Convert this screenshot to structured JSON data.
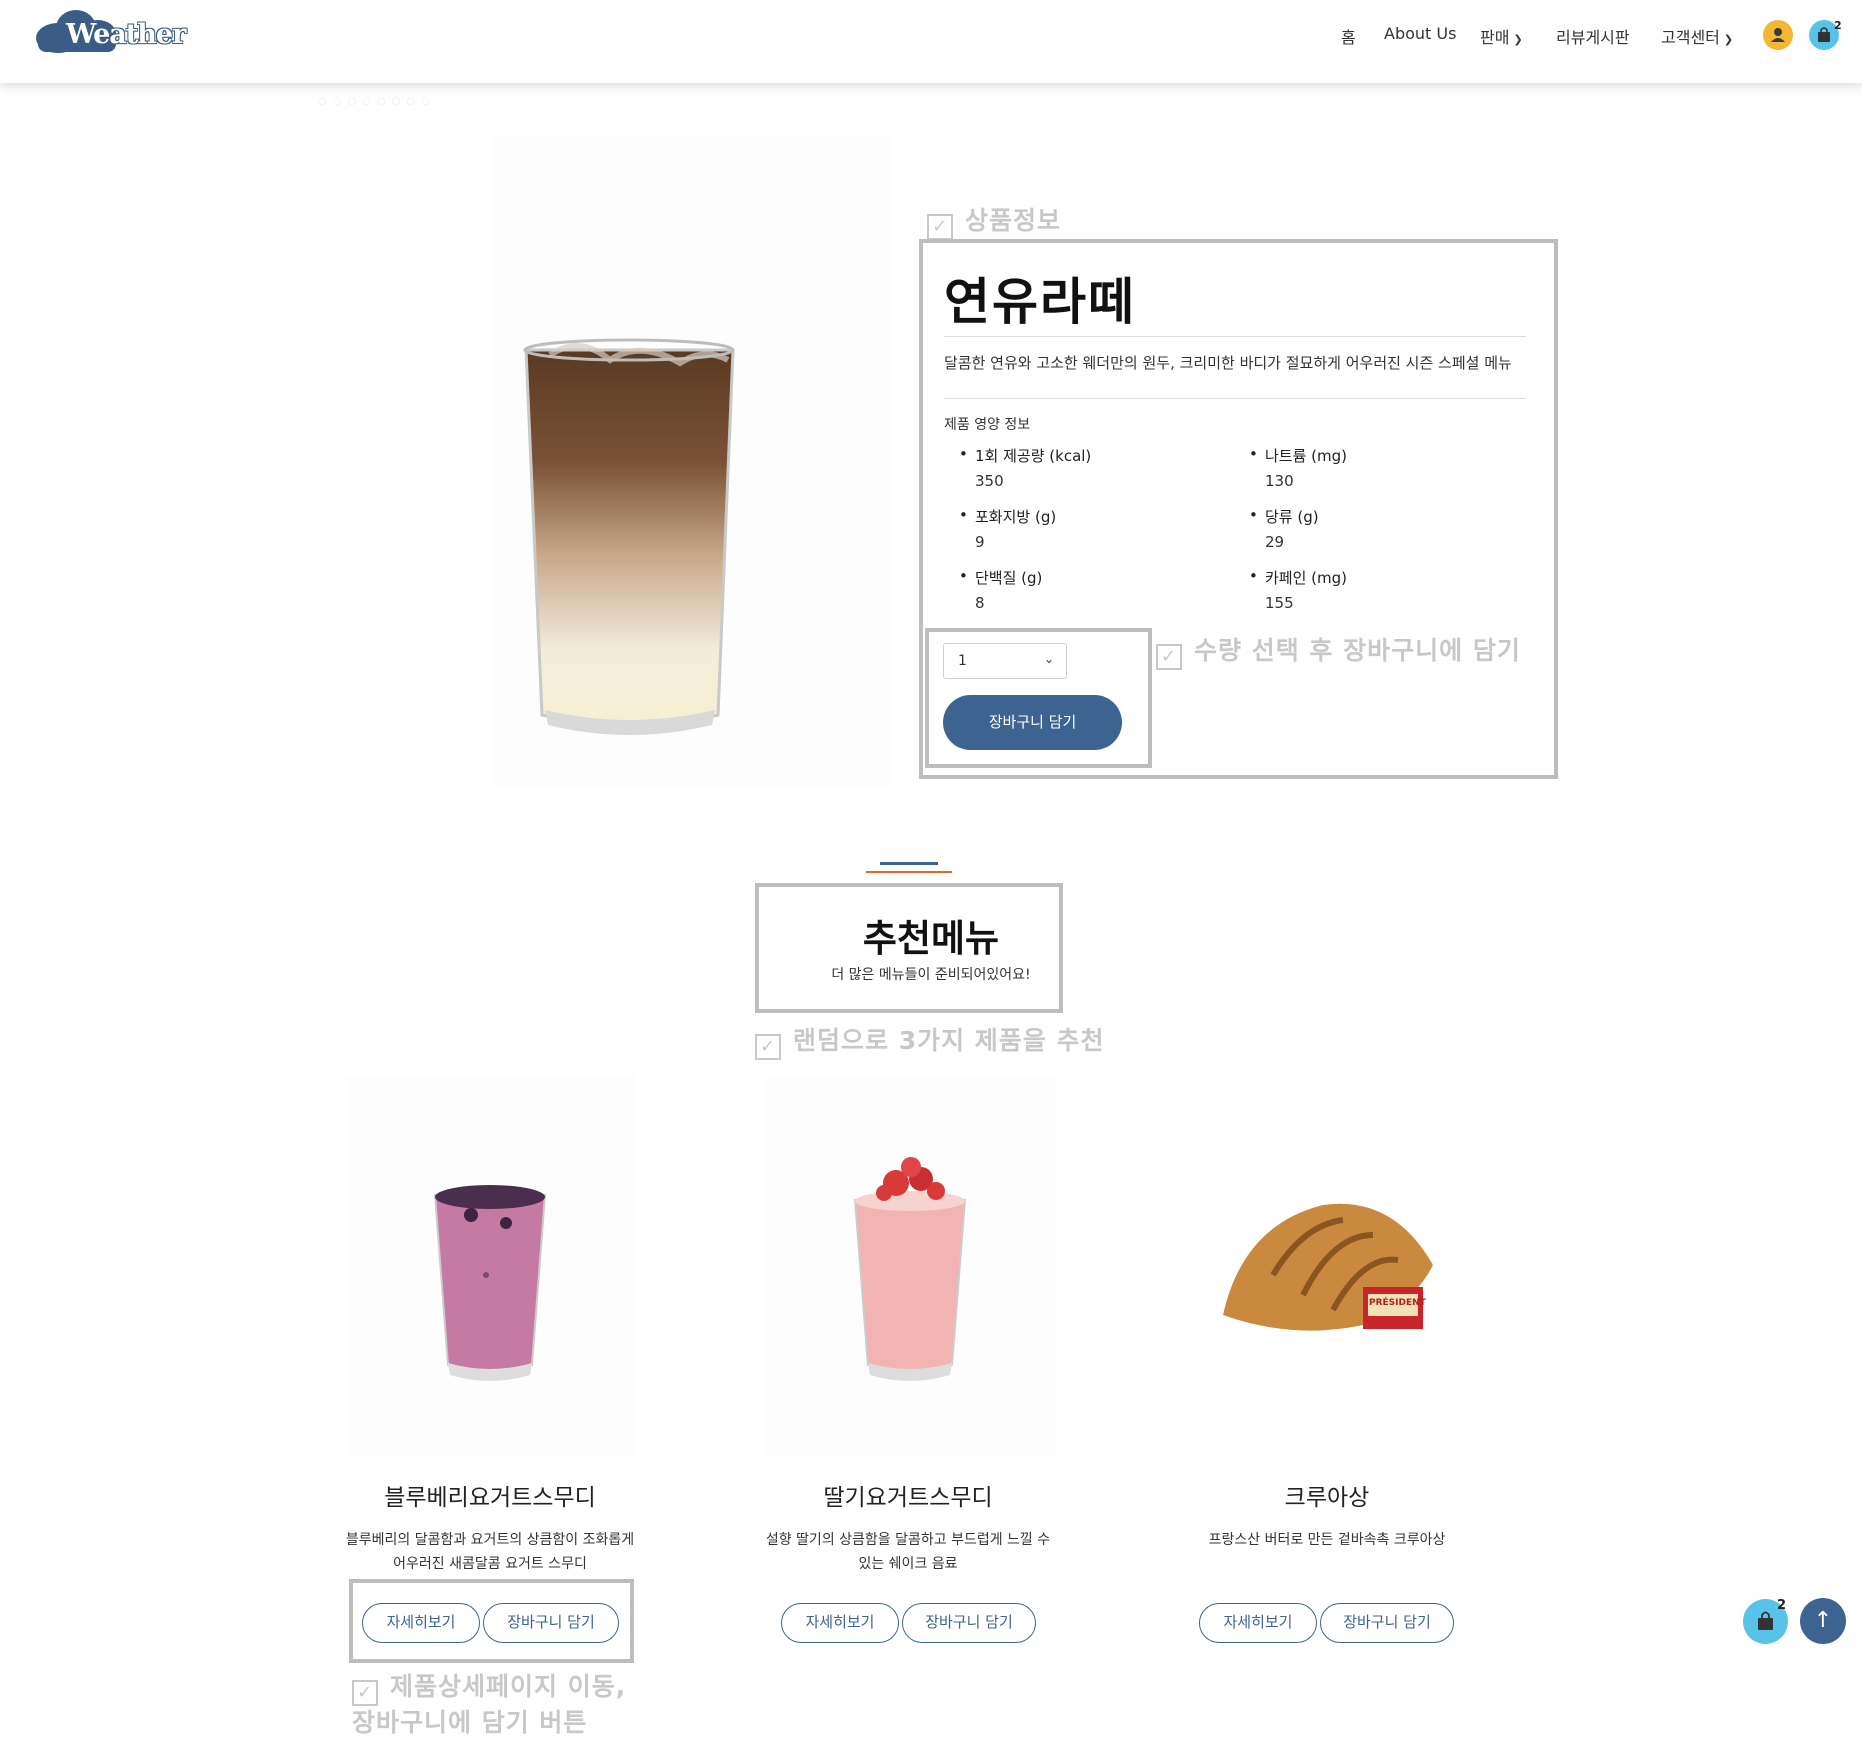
{
  "header": {
    "logo_text": "Weather",
    "nav": [
      {
        "label": "홈"
      },
      {
        "label": "About Us"
      },
      {
        "label": "판매"
      },
      {
        "label": "리뷰게시판"
      },
      {
        "label": "고객센터"
      }
    ],
    "cart_count": "2"
  },
  "product": {
    "section_annotation": "상품정보",
    "name": "연유라떼",
    "description": "달콤한 연유와 고소한 웨더만의 원두, 크리미한 바디가 절묘하게 어우러진 시즌 스페셜 메뉴",
    "nutrition_title": "제품 영양 정보",
    "nutrition": [
      {
        "label": "1회 제공량 (kcal)",
        "value": "350"
      },
      {
        "label": "나트륨 (mg)",
        "value": "130"
      },
      {
        "label": "포화지방 (g)",
        "value": "9"
      },
      {
        "label": "당류 (g)",
        "value": "29"
      },
      {
        "label": "단백질 (g)",
        "value": "8"
      },
      {
        "label": "카페인 (mg)",
        "value": "155"
      }
    ],
    "quantity": "1",
    "add_to_cart_label": "장바구니 담기",
    "quantity_annotation": "수량 선택 후 장바구니에 담기"
  },
  "recommend": {
    "title": "추천메뉴",
    "subtitle": "더 많은 메뉴들이 준비되어있어요!",
    "annotation": "랜덤으로 3가지 제품을 추천",
    "items": [
      {
        "name": "블루베리요거트스무디",
        "desc_line1": "블루베리의 달콤함과 요거트의 상큼함이 조화롭게",
        "desc_line2": "어우러진 새콤달콤 요거트 스무디"
      },
      {
        "name": "딸기요거트스무디",
        "desc_line1": "설향 딸기의 상큼함을 달콤하고 부드럽게 느낄 수",
        "desc_line2": "있는 쉐이크 음료"
      },
      {
        "name": "크루아상",
        "desc_line1": "프랑스산 버터로 만든 겉바속촉 크루아상",
        "desc_line2": ""
      }
    ],
    "detail_label": "자세히보기",
    "cart_label": "장바구니 담기",
    "button_annotation_line1": "제품상세페이지 이동,",
    "button_annotation_line2": "장바구니에 담기 버튼",
    "butter_logo_text": "PRÉSIDENT"
  },
  "floating": {
    "cart_count": "2",
    "top_arrow": "↑"
  },
  "colors": {
    "primary": "#3d6490",
    "accent_orange": "#e06a2c",
    "user_yellow": "#f3b733",
    "cart_cyan": "#58c3e8",
    "annotation_gray": "#c8c8c8"
  }
}
